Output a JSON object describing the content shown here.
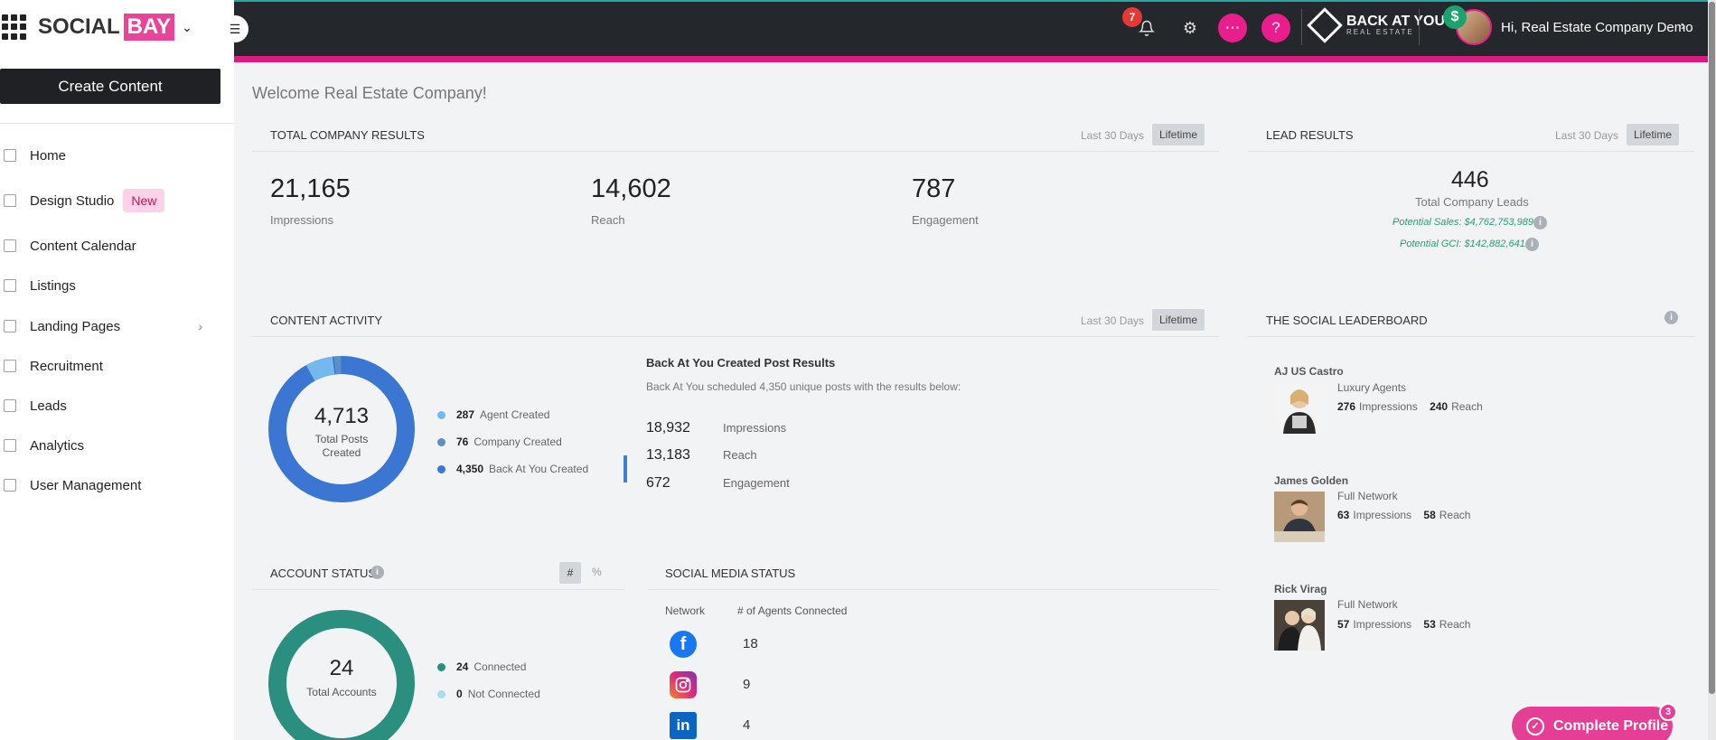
{
  "brand": {
    "name_a": "SOCIAL",
    "name_b": "BAY"
  },
  "sidebar": {
    "create_label": "Create Content",
    "items": [
      {
        "label": "Home"
      },
      {
        "label": "Design Studio",
        "badge": "New"
      },
      {
        "label": "Content Calendar"
      },
      {
        "label": "Listings"
      },
      {
        "label": "Landing Pages"
      },
      {
        "label": "Recruitment"
      },
      {
        "label": "Leads"
      },
      {
        "label": "Analytics"
      },
      {
        "label": "User Management"
      }
    ]
  },
  "topbar": {
    "notifications_count": "7",
    "partner_logo_main": "BACK AT YOU",
    "partner_logo_sub": "REAL ESTATE",
    "dollar_symbol": "$",
    "greeting": "Hi, Real Estate Company Demo"
  },
  "welcome": "Welcome Real Estate Company!",
  "ranges": {
    "last30": "Last 30 Days",
    "lifetime": "Lifetime"
  },
  "company_results": {
    "title": "TOTAL COMPANY RESULTS",
    "stats": [
      {
        "value": "21,165",
        "label": "Impressions"
      },
      {
        "value": "14,602",
        "label": "Reach"
      },
      {
        "value": "787",
        "label": "Engagement"
      }
    ]
  },
  "lead_results": {
    "title": "LEAD RESULTS",
    "value": "446",
    "label": "Total Company Leads",
    "potential_sales": "Potential Sales: $4,762,753,989",
    "potential_gci": "Potential GCI: $142,882,641"
  },
  "content_activity": {
    "title": "CONTENT ACTIVITY",
    "total": "4,713",
    "total_label_1": "Total Posts",
    "total_label_2": "Created",
    "legend": [
      {
        "value": "287",
        "label": "Agent Created",
        "color": "#74b9ee"
      },
      {
        "value": "76",
        "label": "Company Created",
        "color": "#5b8fc7"
      },
      {
        "value": "4,350",
        "label": "Back At You Created",
        "color": "#3a76d2"
      }
    ],
    "bay_title": "Back At You Created Post Results",
    "bay_sub": "Back At You scheduled 4,350 unique posts with the results below:",
    "bay_stats": [
      {
        "value": "18,932",
        "label": "Impressions"
      },
      {
        "value": "13,183",
        "label": "Reach"
      },
      {
        "value": "672",
        "label": "Engagement"
      }
    ]
  },
  "leaderboard": {
    "title": "THE SOCIAL LEADERBOARD",
    "impressions_label": "Impressions",
    "reach_label": "Reach",
    "entries": [
      {
        "name": "AJ US Castro",
        "tier": "Luxury Agents",
        "impressions": "276",
        "reach": "240"
      },
      {
        "name": "James Golden",
        "tier": "Full Network",
        "impressions": "63",
        "reach": "58"
      },
      {
        "name": "Rick Virag",
        "tier": "Full Network",
        "impressions": "57",
        "reach": "53"
      }
    ]
  },
  "account_status": {
    "title": "ACCOUNT STATUS",
    "toggle_hash": "#",
    "toggle_pct": "%",
    "total": "24",
    "total_label": "Total Accounts",
    "legend": [
      {
        "value": "24",
        "label": "Connected",
        "color": "#2a8f7e"
      },
      {
        "value": "0",
        "label": "Not Connected",
        "color": "#a8dcef"
      }
    ]
  },
  "social_status": {
    "title": "SOCIAL MEDIA STATUS",
    "col_network": "Network",
    "col_agents": "# of Agents Connected",
    "rows": [
      {
        "network": "facebook-icon",
        "count": "18"
      },
      {
        "network": "instagram-icon",
        "count": "9"
      },
      {
        "network": "linkedin-icon",
        "count": "4"
      }
    ]
  },
  "complete_profile": {
    "label": "Complete Profile",
    "badge": "3"
  }
}
